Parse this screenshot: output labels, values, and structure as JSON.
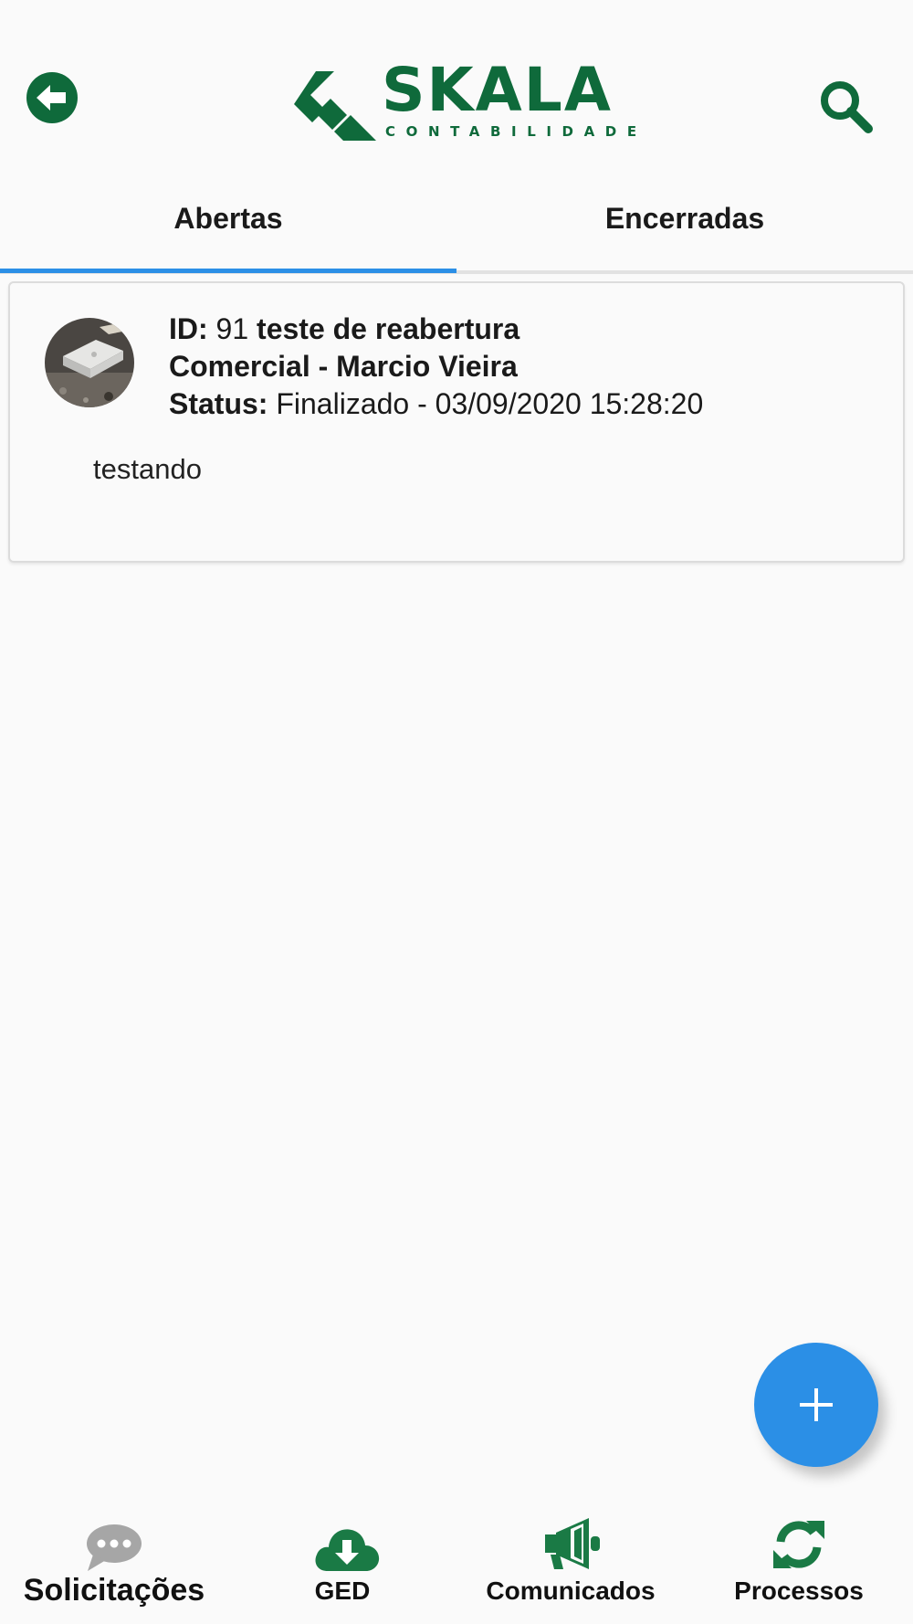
{
  "header": {
    "back_icon": "arrow-circle-left-icon",
    "search_icon": "magnifier-icon",
    "logo_word": "SKALA",
    "logo_sub": "CONTABILIDADE",
    "brand_color": "#0f6a3b"
  },
  "tabs": [
    {
      "label": "Abertas",
      "active": true
    },
    {
      "label": "Encerradas",
      "active": false
    }
  ],
  "accent_color": "#2b8fe6",
  "requests": [
    {
      "id_label": "ID:",
      "id": "91",
      "title": "teste de reabertura",
      "department": "Comercial - Marcio Vieira",
      "status_label": "Status:",
      "status": "Finalizado - 03/09/2020 15:28:20",
      "description": "testando"
    }
  ],
  "fab": {
    "icon": "plus-icon"
  },
  "bottom_nav": [
    {
      "label": "Solicitações",
      "icon": "chat-bubble-icon",
      "active": true
    },
    {
      "label": "GED",
      "icon": "cloud-download-icon",
      "active": false
    },
    {
      "label": "Comunicados",
      "icon": "megaphone-icon",
      "active": false
    },
    {
      "label": "Processos",
      "icon": "sync-icon",
      "active": false
    }
  ]
}
